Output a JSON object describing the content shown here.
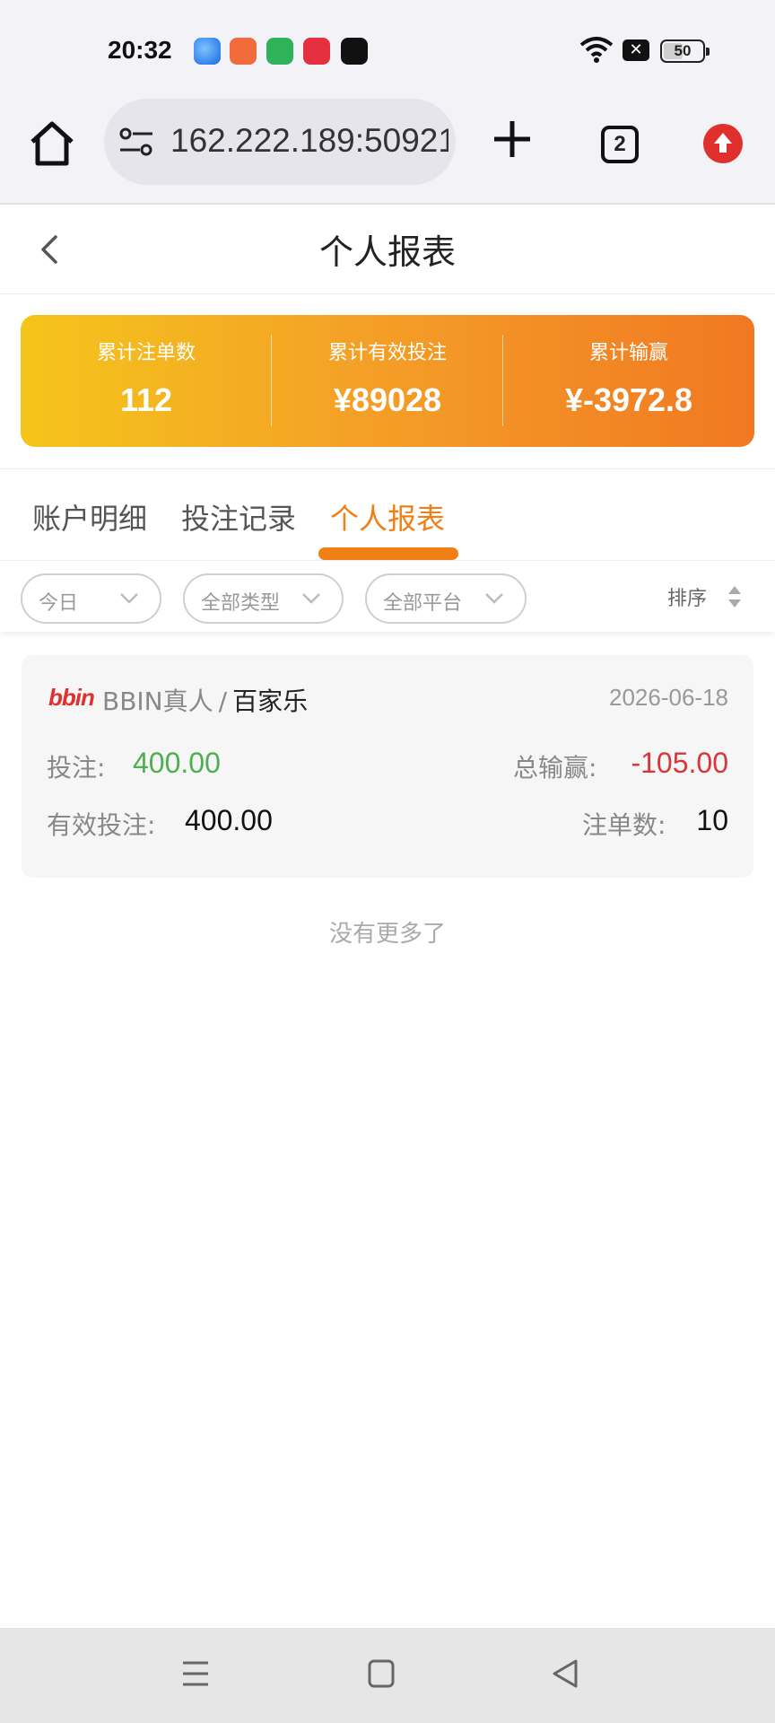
{
  "status_bar": {
    "time": "20:32",
    "battery": "50"
  },
  "browser": {
    "url": "162.222.189:50921",
    "tab_count": "2"
  },
  "header": {
    "title": "个人报表"
  },
  "summary": [
    {
      "label": "累计注单数",
      "value": "112"
    },
    {
      "label": "累计有效投注",
      "value": "¥89028"
    },
    {
      "label": "累计输赢",
      "value": "¥-3972.8"
    }
  ],
  "tabs": [
    {
      "label": "账户明细",
      "active": false
    },
    {
      "label": "投注记录",
      "active": false
    },
    {
      "label": "个人报表",
      "active": true
    }
  ],
  "filters": {
    "date": "今日",
    "type": "全部类型",
    "platform": "全部平台",
    "sort": "排序"
  },
  "record": {
    "logo": "bbin",
    "platform": "BBIN真人",
    "separator": "/",
    "game": "百家乐",
    "date": "2026-06-18",
    "bet_label": "投注:",
    "bet_value": "400.00",
    "win_label": "总输赢:",
    "win_value": "-105.00",
    "valid_label": "有效投注:",
    "valid_value": "400.00",
    "count_label": "注单数:",
    "count_value": "10"
  },
  "footer": {
    "no_more": "没有更多了"
  },
  "colors": {
    "accent": "#f07f14",
    "positive": "#4caf50",
    "negative": "#d8363a"
  }
}
